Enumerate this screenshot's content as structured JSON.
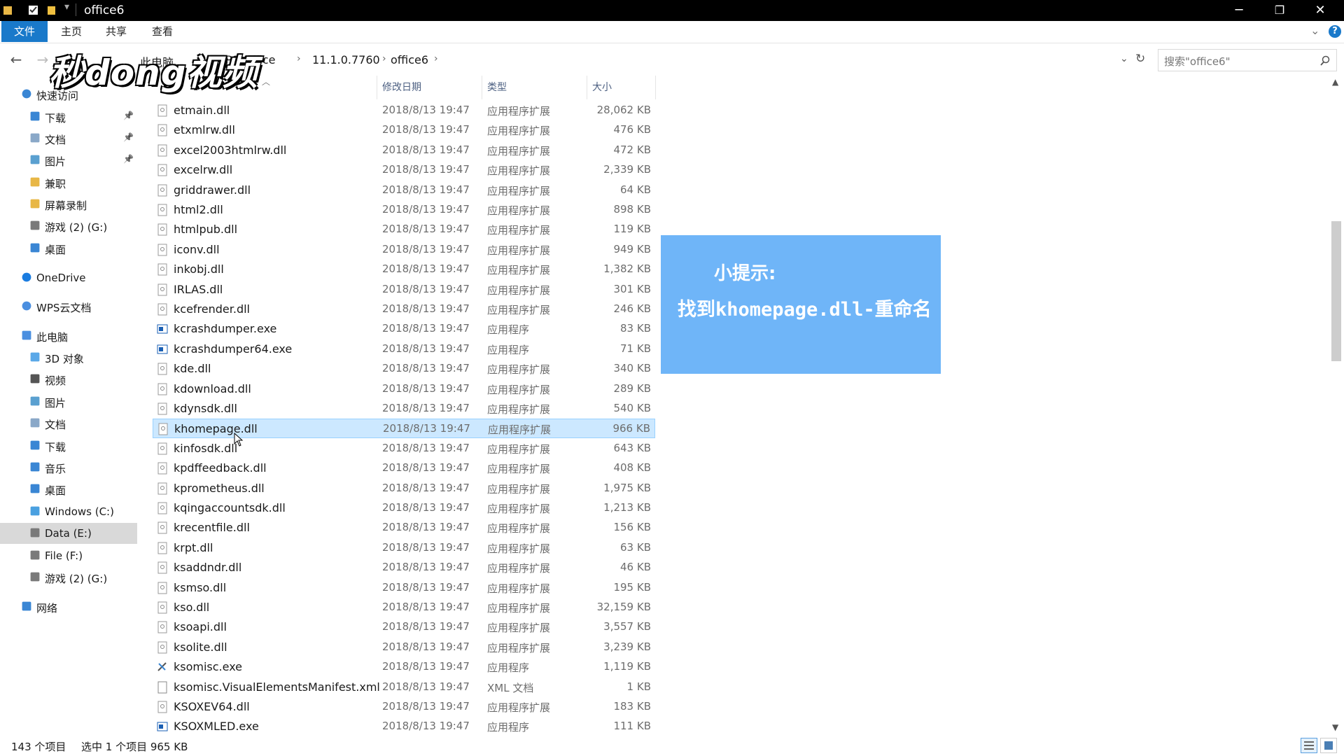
{
  "window": {
    "title": "office6",
    "controls": [
      "minimize-icon",
      "restore-icon",
      "close-icon"
    ]
  },
  "ribbon": {
    "tabs": [
      "文件",
      "主页",
      "共享",
      "查看"
    ]
  },
  "address": {
    "crumbs": [
      "此电脑",
      "WPS Office",
      "11.1.0.7760",
      "office6"
    ],
    "search_placeholder": "搜索\"office6\""
  },
  "watermark": "秒dong视频",
  "sidebar": {
    "items": [
      {
        "label": "快速访问",
        "icon": "star-icon",
        "level": 0
      },
      {
        "label": "下载",
        "icon": "download-folder-icon",
        "level": 1,
        "pinned": true
      },
      {
        "label": "文档",
        "icon": "documents-folder-icon",
        "level": 1,
        "pinned": true
      },
      {
        "label": "图片",
        "icon": "pictures-folder-icon",
        "level": 1,
        "pinned": true
      },
      {
        "label": "兼职",
        "icon": "folder-icon",
        "level": 1
      },
      {
        "label": "屏幕录制",
        "icon": "folder-icon",
        "level": 1
      },
      {
        "label": "游戏 (2) (G:)",
        "icon": "drive-icon",
        "level": 1
      },
      {
        "label": "桌面",
        "icon": "desktop-folder-icon",
        "level": 1
      },
      {
        "label": "OneDrive",
        "icon": "cloud-icon",
        "level": 0
      },
      {
        "label": "WPS云文档",
        "icon": "wps-cloud-icon",
        "level": 0
      },
      {
        "label": "此电脑",
        "icon": "computer-icon",
        "level": 0
      },
      {
        "label": "3D 对象",
        "icon": "3d-objects-icon",
        "level": 1
      },
      {
        "label": "视频",
        "icon": "video-folder-icon",
        "level": 1
      },
      {
        "label": "图片",
        "icon": "pictures-folder-icon",
        "level": 1
      },
      {
        "label": "文档",
        "icon": "documents-folder-icon",
        "level": 1
      },
      {
        "label": "下载",
        "icon": "download-folder-icon",
        "level": 1
      },
      {
        "label": "音乐",
        "icon": "music-folder-icon",
        "level": 1
      },
      {
        "label": "桌面",
        "icon": "desktop-folder-icon",
        "level": 1
      },
      {
        "label": "Windows (C:)",
        "icon": "windows-drive-icon",
        "level": 1
      },
      {
        "label": "Data (E:)",
        "icon": "drive-icon",
        "level": 1,
        "selected": true
      },
      {
        "label": "File (F:)",
        "icon": "drive-icon",
        "level": 1
      },
      {
        "label": "游戏 (2) (G:)",
        "icon": "drive-icon",
        "level": 1
      },
      {
        "label": "网络",
        "icon": "network-icon",
        "level": 0
      }
    ]
  },
  "columns": [
    "修改日期",
    "类型",
    "大小"
  ],
  "files": [
    {
      "name": "etmain.dll",
      "date": "2018/8/13 19:47",
      "type": "应用程序扩展",
      "size": "28,062 KB",
      "icon": "dll-icon"
    },
    {
      "name": "etxmlrw.dll",
      "date": "2018/8/13 19:47",
      "type": "应用程序扩展",
      "size": "476 KB",
      "icon": "dll-icon"
    },
    {
      "name": "excel2003htmlrw.dll",
      "date": "2018/8/13 19:47",
      "type": "应用程序扩展",
      "size": "472 KB",
      "icon": "dll-icon"
    },
    {
      "name": "excelrw.dll",
      "date": "2018/8/13 19:47",
      "type": "应用程序扩展",
      "size": "2,339 KB",
      "icon": "dll-icon"
    },
    {
      "name": "griddrawer.dll",
      "date": "2018/8/13 19:47",
      "type": "应用程序扩展",
      "size": "64 KB",
      "icon": "dll-icon"
    },
    {
      "name": "html2.dll",
      "date": "2018/8/13 19:47",
      "type": "应用程序扩展",
      "size": "898 KB",
      "icon": "dll-icon"
    },
    {
      "name": "htmlpub.dll",
      "date": "2018/8/13 19:47",
      "type": "应用程序扩展",
      "size": "119 KB",
      "icon": "dll-icon"
    },
    {
      "name": "iconv.dll",
      "date": "2018/8/13 19:47",
      "type": "应用程序扩展",
      "size": "949 KB",
      "icon": "dll-icon"
    },
    {
      "name": "inkobj.dll",
      "date": "2018/8/13 19:47",
      "type": "应用程序扩展",
      "size": "1,382 KB",
      "icon": "dll-icon"
    },
    {
      "name": "IRLAS.dll",
      "date": "2018/8/13 19:47",
      "type": "应用程序扩展",
      "size": "301 KB",
      "icon": "dll-icon"
    },
    {
      "name": "kcefrender.dll",
      "date": "2018/8/13 19:47",
      "type": "应用程序扩展",
      "size": "246 KB",
      "icon": "dll-icon"
    },
    {
      "name": "kcrashdumper.exe",
      "date": "2018/8/13 19:47",
      "type": "应用程序",
      "size": "83 KB",
      "icon": "exe-icon"
    },
    {
      "name": "kcrashdumper64.exe",
      "date": "2018/8/13 19:47",
      "type": "应用程序",
      "size": "71 KB",
      "icon": "exe-icon"
    },
    {
      "name": "kde.dll",
      "date": "2018/8/13 19:47",
      "type": "应用程序扩展",
      "size": "340 KB",
      "icon": "dll-icon"
    },
    {
      "name": "kdownload.dll",
      "date": "2018/8/13 19:47",
      "type": "应用程序扩展",
      "size": "289 KB",
      "icon": "dll-icon"
    },
    {
      "name": "kdynsdk.dll",
      "date": "2018/8/13 19:47",
      "type": "应用程序扩展",
      "size": "540 KB",
      "icon": "dll-icon"
    },
    {
      "name": "khomepage.dll",
      "date": "2018/8/13 19:47",
      "type": "应用程序扩展",
      "size": "966 KB",
      "icon": "dll-icon",
      "selected": true
    },
    {
      "name": "kinfosdk.dll",
      "date": "2018/8/13 19:47",
      "type": "应用程序扩展",
      "size": "643 KB",
      "icon": "dll-icon"
    },
    {
      "name": "kpdffeedback.dll",
      "date": "2018/8/13 19:47",
      "type": "应用程序扩展",
      "size": "408 KB",
      "icon": "dll-icon"
    },
    {
      "name": "kprometheus.dll",
      "date": "2018/8/13 19:47",
      "type": "应用程序扩展",
      "size": "1,975 KB",
      "icon": "dll-icon"
    },
    {
      "name": "kqingaccountsdk.dll",
      "date": "2018/8/13 19:47",
      "type": "应用程序扩展",
      "size": "1,213 KB",
      "icon": "dll-icon"
    },
    {
      "name": "krecentfile.dll",
      "date": "2018/8/13 19:47",
      "type": "应用程序扩展",
      "size": "156 KB",
      "icon": "dll-icon"
    },
    {
      "name": "krpt.dll",
      "date": "2018/8/13 19:47",
      "type": "应用程序扩展",
      "size": "63 KB",
      "icon": "dll-icon"
    },
    {
      "name": "ksaddndr.dll",
      "date": "2018/8/13 19:47",
      "type": "应用程序扩展",
      "size": "46 KB",
      "icon": "dll-icon"
    },
    {
      "name": "ksmso.dll",
      "date": "2018/8/13 19:47",
      "type": "应用程序扩展",
      "size": "195 KB",
      "icon": "dll-icon"
    },
    {
      "name": "kso.dll",
      "date": "2018/8/13 19:47",
      "type": "应用程序扩展",
      "size": "32,159 KB",
      "icon": "dll-icon"
    },
    {
      "name": "ksoapi.dll",
      "date": "2018/8/13 19:47",
      "type": "应用程序扩展",
      "size": "3,557 KB",
      "icon": "dll-icon"
    },
    {
      "name": "ksolite.dll",
      "date": "2018/8/13 19:47",
      "type": "应用程序扩展",
      "size": "3,239 KB",
      "icon": "dll-icon"
    },
    {
      "name": "ksomisc.exe",
      "date": "2018/8/13 19:47",
      "type": "应用程序",
      "size": "1,119 KB",
      "icon": "tools-exe-icon"
    },
    {
      "name": "ksomisc.VisualElementsManifest.xml",
      "date": "2018/8/13 19:47",
      "type": "XML 文档",
      "size": "1 KB",
      "icon": "xml-file-icon"
    },
    {
      "name": "KSOXEV64.dll",
      "date": "2018/8/13 19:47",
      "type": "应用程序扩展",
      "size": "183 KB",
      "icon": "dll-icon"
    },
    {
      "name": "KSOXMLED.exe",
      "date": "2018/8/13 19:47",
      "type": "应用程序",
      "size": "111 KB",
      "icon": "exe-icon"
    }
  ],
  "tip": {
    "title": "小提示:",
    "text": "找到khomepage.dll-重命名"
  },
  "status": {
    "count": "143 个项目",
    "selection": "选中 1 个项目 965 KB"
  },
  "colors": {
    "file_tab": "#1979ca",
    "selection": "#cce8ff",
    "tip_bg": "#6fb5f8"
  }
}
